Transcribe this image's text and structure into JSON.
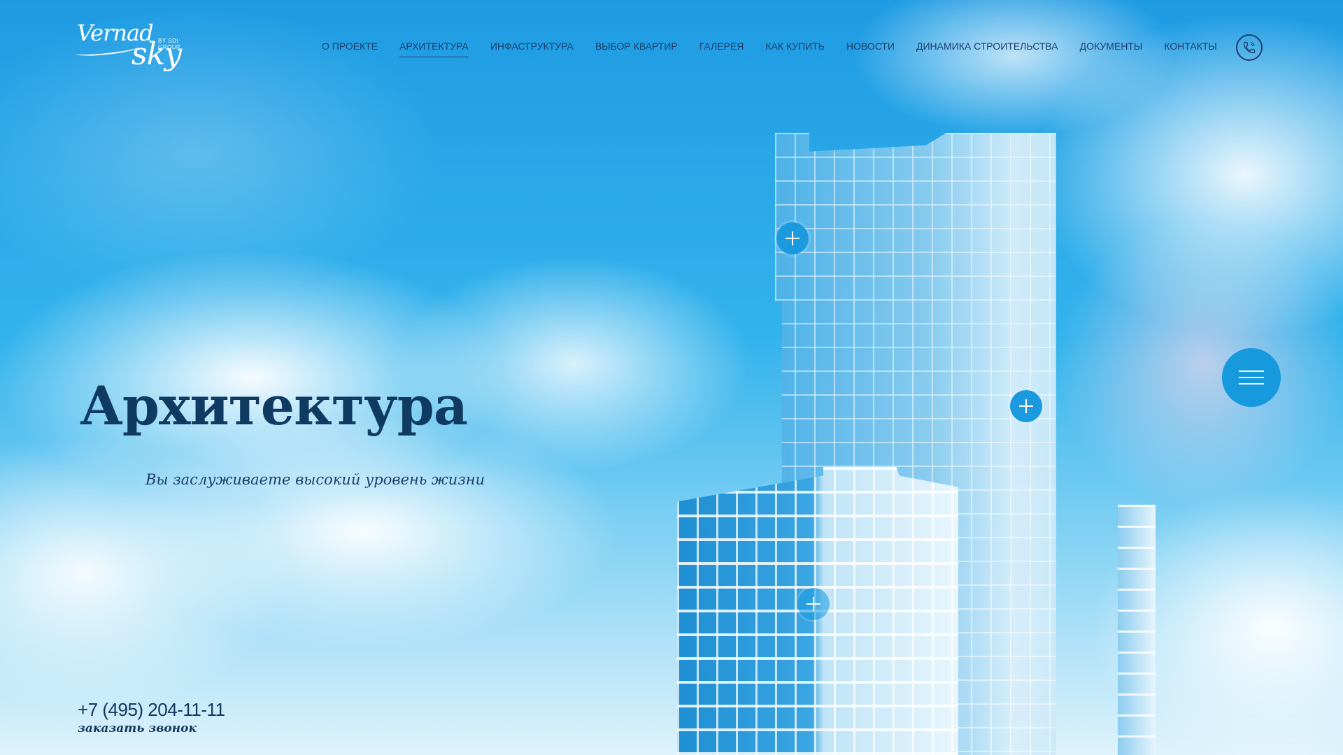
{
  "logo": {
    "line1": "Vernad",
    "line2": "sky",
    "tagline": "BY SDI GROUP"
  },
  "nav": {
    "items": [
      {
        "label": "О ПРОЕКТЕ"
      },
      {
        "label": "АРХИТЕКТУРА",
        "active": true
      },
      {
        "label": "ИНФАСТРУКТУРА"
      },
      {
        "label": "ВЫБОР КВАРТИР"
      },
      {
        "label": "ГАЛЕРЕЯ"
      },
      {
        "label": "КАК КУПИТЬ"
      },
      {
        "label": "НОВОСТИ"
      },
      {
        "label": "ДИНАМИКА СТРОИТЕЛЬСТВА"
      },
      {
        "label": "ДОКУМЕНТЫ"
      },
      {
        "label": "КОНТАКТЫ"
      }
    ],
    "phone_icon": "phone-icon"
  },
  "hero": {
    "title": "Архитектура",
    "subtitle": "Вы заслуживаете высокий уровень жизни"
  },
  "contact": {
    "phone": "+7 (495) 204-11-11",
    "callback": "заказать звонок"
  },
  "menu": {
    "icon": "hamburger-icon"
  },
  "hotspots": [
    {
      "icon": "plus-icon"
    },
    {
      "icon": "plus-icon"
    },
    {
      "icon": "plus-icon"
    }
  ],
  "colors": {
    "accent": "#1699dd",
    "text_dark": "#1d3f6b",
    "heading": "#0f3a62"
  }
}
